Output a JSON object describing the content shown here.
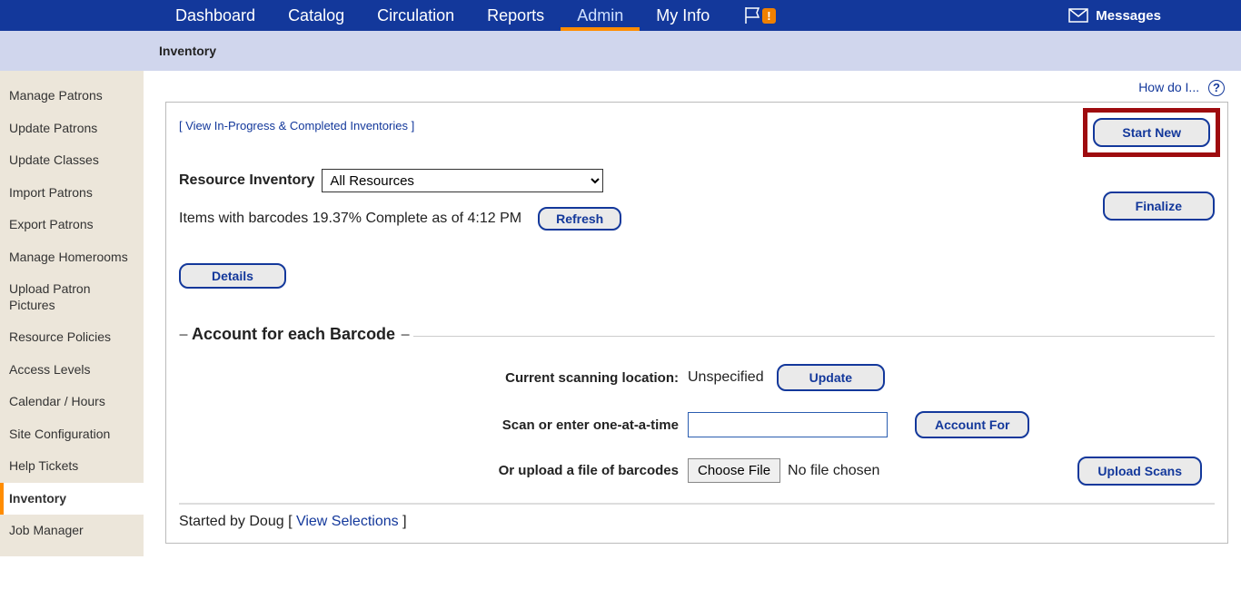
{
  "nav": {
    "items": [
      "Dashboard",
      "Catalog",
      "Circulation",
      "Reports",
      "Admin",
      "My Info"
    ],
    "active": "Admin",
    "messages": "Messages"
  },
  "subbar": {
    "title": "Inventory"
  },
  "sidebar": {
    "items": [
      "Manage Patrons",
      "Update Patrons",
      "Update Classes",
      "Import Patrons",
      "Export Patrons",
      "Manage Homerooms",
      "Upload Patron Pictures",
      "Resource Policies",
      "Access Levels",
      "Calendar / Hours",
      "Site Configuration",
      "Help Tickets",
      "Inventory",
      "Job Manager"
    ],
    "active": "Inventory"
  },
  "help": {
    "text": "How do I...",
    "q": "?"
  },
  "panel": {
    "view_link": "View In-Progress & Completed Inventories",
    "start_new": "Start New",
    "resource_label": "Resource Inventory",
    "resource_value": "All Resources",
    "status_text": "Items with barcodes 19.37% Complete as of 4:12 PM",
    "refresh": "Refresh",
    "finalize": "Finalize",
    "details": "Details",
    "section_title": "Account for each Barcode",
    "scan_loc_label": "Current scanning location:",
    "scan_loc_value": "Unspecified",
    "update": "Update",
    "scan_enter_label": "Scan or enter one-at-a-time",
    "account_for": "Account For",
    "upload_file_label": "Or upload a file of barcodes",
    "choose_file": "Choose File",
    "no_file": "No file chosen",
    "upload_scans": "Upload Scans",
    "started_by": "Started by Doug  ",
    "view_selections": "View Selections"
  }
}
